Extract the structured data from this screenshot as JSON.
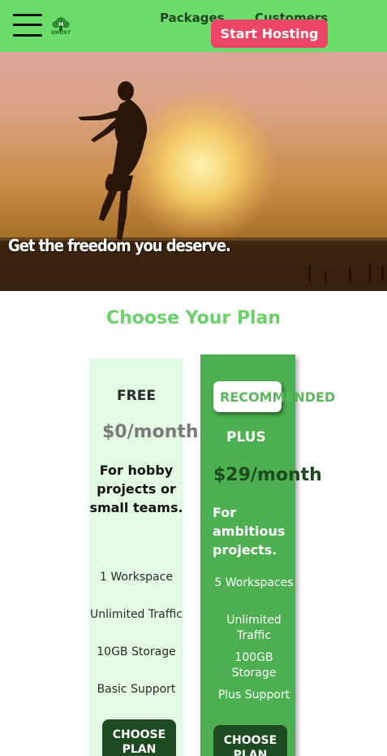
{
  "header": {
    "logo_text": "UHOST",
    "nav": [
      {
        "label": "Packages"
      },
      {
        "label": "Customers"
      }
    ],
    "cta_label": "Start Hosting"
  },
  "hero": {
    "tagline": "Get the freedom you deserve."
  },
  "plans": {
    "title": "Choose Your Plan",
    "recommended_badge": "RECOMMENDED",
    "items": [
      {
        "name": "FREE",
        "price": "$0/month",
        "tagline": "For hobby projects or small teams.",
        "features": [
          "1 Workspace",
          "Unlimited Traffic",
          "10GB Storage",
          "Basic Support"
        ],
        "button": "CHOOSE PLAN"
      },
      {
        "name": "PLUS",
        "price": "$29/month",
        "tagline": "For ambitious projects.",
        "features": [
          "5 Workspaces",
          "Unlimited Traffic",
          "100GB Storage",
          "Plus Support"
        ],
        "button": "CHOOSE PLAN"
      }
    ]
  },
  "colors": {
    "header_bg": "#6bdd6a",
    "cta_bg": "#ed4566",
    "plus_card_bg": "#4caf50",
    "free_card_bg": "#e4fbe3",
    "button_bg": "#1e4a21",
    "title_color": "#6bd06a"
  }
}
